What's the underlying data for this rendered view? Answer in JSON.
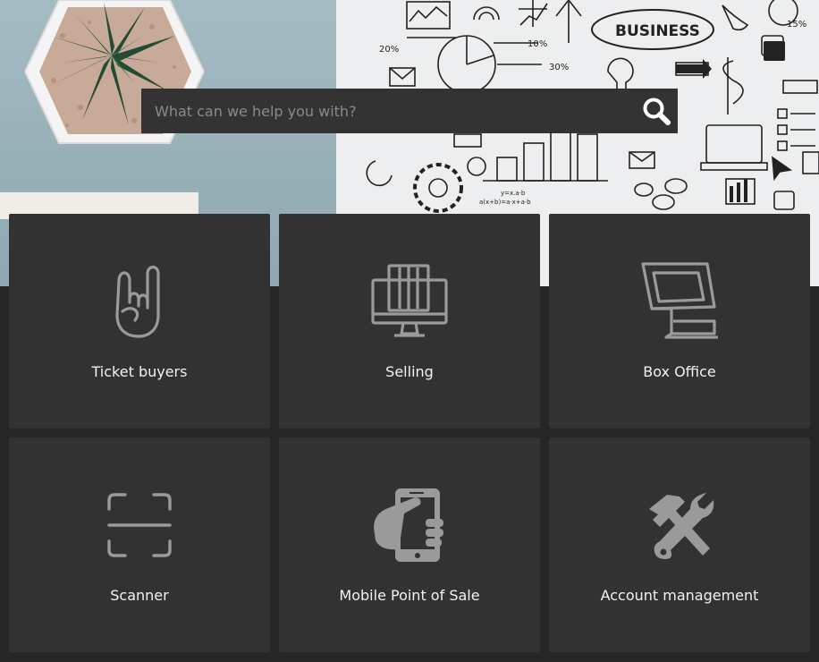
{
  "search": {
    "placeholder": "What can we help you with?",
    "icon": "search-icon"
  },
  "hero": {
    "left_color": "#9bb2ba",
    "right_color": "#eceeef"
  },
  "tiles": [
    {
      "label": "Ticket buyers",
      "icon": "rock-hand-icon"
    },
    {
      "label": "Selling",
      "icon": "desktop-computer-icon"
    },
    {
      "label": "Box Office",
      "icon": "pos-terminal-icon"
    },
    {
      "label": "Scanner",
      "icon": "scanner-icon"
    },
    {
      "label": "Mobile Point of Sale",
      "icon": "hand-phone-icon"
    },
    {
      "label": "Account management",
      "icon": "tools-icon"
    }
  ],
  "colors": {
    "page_background": "#262626",
    "tile_background": "#323232",
    "icon_color": "#9a9a9a",
    "label_color": "#f2f2f2"
  }
}
